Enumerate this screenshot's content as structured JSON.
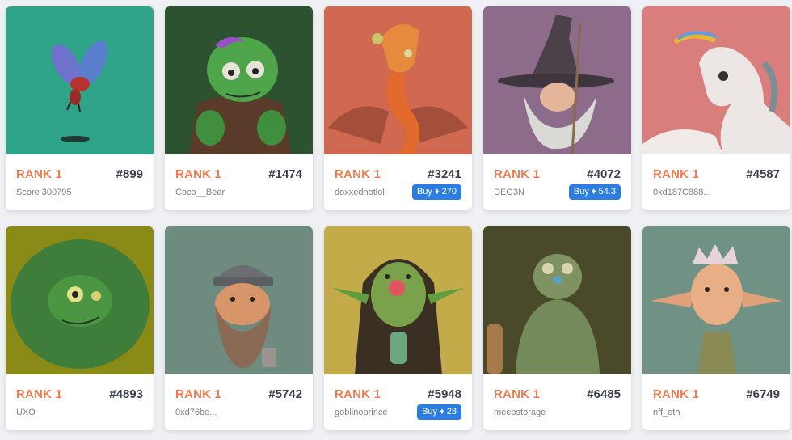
{
  "colors": {
    "rank": "#ee7d52",
    "buy_button": "#2b7de0",
    "background": "#eef0f3"
  },
  "cards": [
    {
      "rank": "RANK 1",
      "token": "#899",
      "owner": "Score 300795",
      "buy": null,
      "art": "winged-bug-creature",
      "bg": "#2fa488"
    },
    {
      "rank": "RANK 1",
      "token": "#1474",
      "owner": "Coco__Bear",
      "buy": null,
      "art": "green-zombie-creature",
      "bg": "#2c5230"
    },
    {
      "rank": "RANK 1",
      "token": "#3241",
      "owner": "doxxednotlol",
      "buy": "Buy ♦ 270",
      "art": "orange-bat-creature",
      "bg": "#d0694f"
    },
    {
      "rank": "RANK 1",
      "token": "#4072",
      "owner": "DEG3N",
      "buy": "Buy ♦ 54.3",
      "art": "bearded-wizard",
      "bg": "#8d6b8a"
    },
    {
      "rank": "RANK 1",
      "token": "#4587",
      "owner": "0xd187C888...",
      "buy": null,
      "art": "rainbow-unicorn",
      "bg": "#da7d7d"
    },
    {
      "rank": "RANK 1",
      "token": "#4893",
      "owner": "UXO",
      "buy": null,
      "art": "green-troll",
      "bg": "#8a8a16"
    },
    {
      "rank": "RANK 1",
      "token": "#5742",
      "owner": "0xd76be...",
      "buy": null,
      "art": "helmeted-dwarf",
      "bg": "#6e8b80"
    },
    {
      "rank": "RANK 1",
      "token": "#5948",
      "owner": "goblinoprince",
      "buy": "Buy ♦ 28",
      "art": "long-haired-goblin",
      "bg": "#c4ab49"
    },
    {
      "rank": "RANK 1",
      "token": "#6485",
      "owner": "meepstorage",
      "buy": null,
      "art": "club-wielding-ogre",
      "bg": "#4a4a2a"
    },
    {
      "rank": "RANK 1",
      "token": "#6749",
      "owner": "nff_eth",
      "buy": null,
      "art": "spiky-haired-goblin",
      "bg": "#6f9284"
    }
  ]
}
